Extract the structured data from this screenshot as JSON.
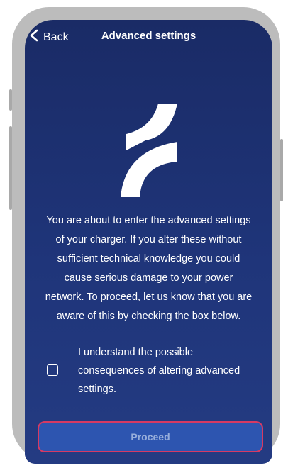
{
  "header": {
    "back_label": "Back",
    "title": "Advanced settings"
  },
  "warning": {
    "lines": [
      "You are about to enter the advanced settings",
      "of your charger. If you alter these without",
      "sufficient technical knowledge you could",
      "cause serious damage to your power",
      "network. To proceed, let us know that you are",
      "aware of this by checking the box below."
    ]
  },
  "consent": {
    "checked": false,
    "lines": [
      "I understand the possible",
      "consequences of altering advanced",
      "settings."
    ]
  },
  "actions": {
    "proceed_label": "Proceed",
    "proceed_enabled": false
  },
  "colors": {
    "background_top": "#1a2b66",
    "background_bottom": "#243b82",
    "proceed_fill": "#2d55b0",
    "proceed_border": "#d63a63",
    "proceed_text": "#97aedb"
  },
  "icons": {
    "back": "chevron-left-icon",
    "logo": "brand-logo",
    "checkbox": "checkbox-unchecked-icon"
  }
}
